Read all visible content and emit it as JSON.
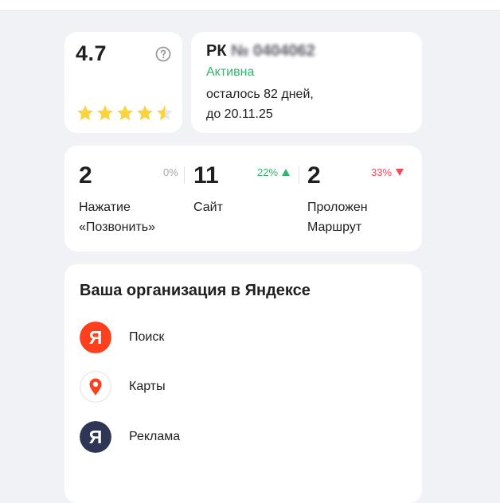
{
  "rating": {
    "value": "4.7",
    "stars_filled": 4.5,
    "stars_total": 5
  },
  "subscription": {
    "title_prefix": "РК",
    "title_masked": "№ 0404062",
    "status": "Активна",
    "days_left": "осталось 82 дней,",
    "until": "до 20.11.25"
  },
  "stats": [
    {
      "value": "2",
      "percent": "0%",
      "trend": "none",
      "label": "Нажатие\n«Позвонить»"
    },
    {
      "value": "11",
      "percent": "22%",
      "trend": "up",
      "label": "Сайт"
    },
    {
      "value": "2",
      "percent": "33%",
      "trend": "down",
      "label": "Проложен\nМаршрут"
    }
  ],
  "organization": {
    "title": "Ваша организация в Яндексе",
    "items": [
      {
        "label": "Поиск",
        "icon": "yandex-search-icon"
      },
      {
        "label": "Карты",
        "icon": "yandex-maps-icon"
      },
      {
        "label": "Реклама",
        "icon": "yandex-ads-icon"
      }
    ]
  },
  "colors": {
    "active_green": "#33b36b",
    "up_green": "#33b36b",
    "down_red": "#f2495e",
    "star_gold": "#fcd33a",
    "yandex_red": "#fc3f1d",
    "ads_dark": "#2f3554"
  }
}
